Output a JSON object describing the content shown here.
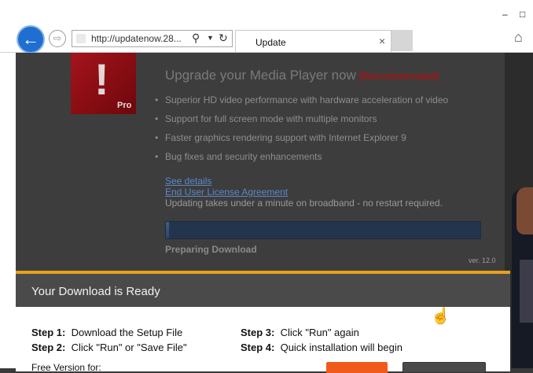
{
  "browser": {
    "url": "http://updatenow.28...",
    "tab_title": "Update",
    "tab_close": "×",
    "window_minimize": "–",
    "window_restore": "□"
  },
  "icons": {
    "back": "back-arrow-icon",
    "forward": "forward-arrow-icon",
    "search": "search-icon",
    "refresh": "refresh-icon",
    "home": "home-icon",
    "cursor": "hand-cursor-icon"
  },
  "promo": {
    "logo_mark": "!",
    "logo_label": "Pro",
    "headline": "Upgrade your Media Player now",
    "recommended": "(Recommended)",
    "features": [
      "Superior HD video performance with hardware acceleration of video",
      "Support for full screen mode with multiple monitors",
      "Faster graphics rendering support with Internet Explorer 9",
      "Bug fixes and security enhancements"
    ],
    "link_details": "See details",
    "link_eula": "End User License Agreement",
    "note": "Updating takes under a minute on broadband - no restart required.",
    "progress_fraction": 0.01,
    "status": "Preparing Download",
    "version": "ver. 12.0"
  },
  "download": {
    "title": "Your Download is Ready",
    "steps": [
      {
        "label": "Step 1:",
        "text": "Download the Setup File"
      },
      {
        "label": "Step 2:",
        "text": "Click \"Run\" or \"Save File\""
      },
      {
        "label": "Step 3:",
        "text": "Click \"Run\" again"
      },
      {
        "label": "Step 4:",
        "text": "Quick installation will begin"
      }
    ],
    "free_version": "Free Version for:"
  },
  "colors": {
    "accent_orange": "#e6a21d",
    "back_blue": "#1e6fd0",
    "logo_red": "#8b0b12",
    "run_button": "#f05a1a"
  }
}
